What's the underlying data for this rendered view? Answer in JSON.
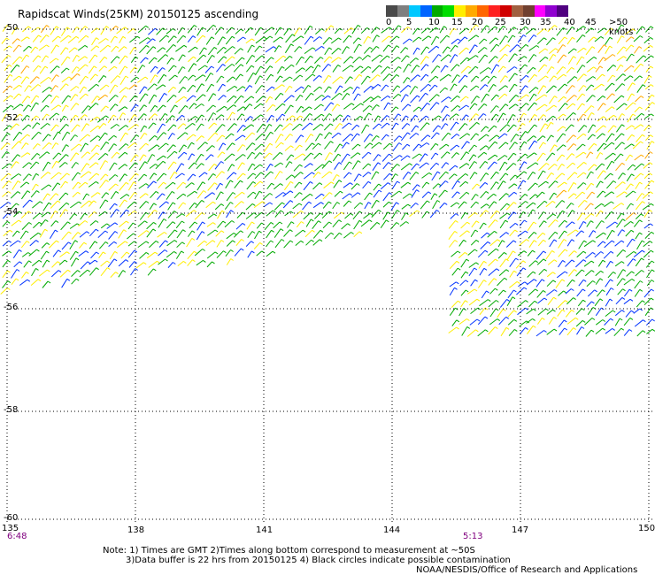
{
  "title": "Rapidscat Winds(25KM) 20150125 ascending",
  "legend": {
    "labels": [
      "0",
      "5",
      "10",
      "15",
      "20",
      "25",
      "30",
      "35",
      "40",
      "45",
      ">50 knots"
    ],
    "colors": [
      "#4a4a4a",
      "#7f7f7f",
      "#00c8ff",
      "#0064ff",
      "#00aa00",
      "#00dd00",
      "#ffee00",
      "#ffaa00",
      "#ff6600",
      "#ff2020",
      "#d00000",
      "#a06040",
      "#704030",
      "#ff00ff",
      "#9000d0",
      "#500080"
    ]
  },
  "lat_labels": [
    "-50",
    "-52",
    "-54",
    "-56",
    "-58",
    "-60"
  ],
  "lon_labels": [
    "135",
    "138",
    "141",
    "144",
    "147",
    "150"
  ],
  "times": [
    "6:48",
    "5:13"
  ],
  "notes": [
    "Note: 1) Times are GMT 2)Times along bottom correspond to measurement at ~50S",
    "3)Data buffer is 22 hrs from 20150125 4) Black circles indicate possible contamination",
    "NOAA/NESDIS/Office of Research and Applications"
  ],
  "colors": {
    "grid": "#000000",
    "wind_light": "#0032ff",
    "wind_moderate": "#00aa00",
    "wind_fresh": "#ffee00",
    "wind_strong": "#ffaa00",
    "time_text": "#80007f"
  }
}
